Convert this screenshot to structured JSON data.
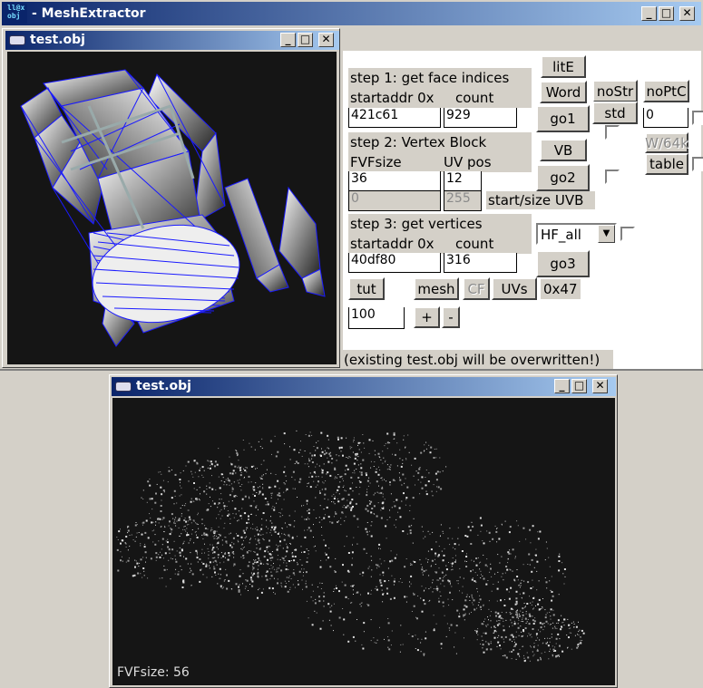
{
  "main_window": {
    "title_icon_line1": "ll@x",
    "title_icon_line2": "obj",
    "title": "- MeshExtractor",
    "minimize": "_",
    "maximize": "□",
    "close": "✕"
  },
  "viewer_top": {
    "title": "test.obj",
    "minimize": "_",
    "maximize": "□",
    "close": "✕"
  },
  "viewer_bottom": {
    "title": "test.obj",
    "minimize": "_",
    "maximize": "□",
    "close": "✕",
    "status": "FVFsize: 56"
  },
  "panel": {
    "step1": {
      "heading": "step 1: get face indices",
      "startaddr_label": "startaddr 0x",
      "count_label": "count",
      "startaddr_value": "421c61",
      "count_value": "929"
    },
    "step2": {
      "heading": "step 2: Vertex Block",
      "fvfsize_label": "FVFsize",
      "uvpos_label": "UV pos",
      "fvfsize_value": "36",
      "uvpos_value": "12",
      "start_value": "0",
      "size_value": "255",
      "startsize_label": "start/size UVB"
    },
    "step3": {
      "heading": "step 3: get vertices",
      "startaddr_label": "startaddr 0x",
      "count_label": "count",
      "startaddr_value": "40df80",
      "count_value": "316"
    },
    "buttons": {
      "lite": "litE",
      "word": "Word",
      "nostr": "noStr",
      "noptc": "noPtC",
      "go1": "go1",
      "std": "std",
      "w64k": "W/64k",
      "vb": "VB",
      "table": "table",
      "go2": "go2",
      "go3": "go3",
      "tut": "tut",
      "mesh": "mesh",
      "cf": "CF",
      "uvs": "UVs",
      "plus": "+",
      "minus": "-"
    },
    "side_field_value": "0",
    "dropdown_value": "HF_all",
    "dropdown_arrow": "▼",
    "hex_label": "0x47",
    "scale_value": "100",
    "warning": "(existing test.obj will be overwritten!)"
  },
  "colors": {
    "titlebar_start": "#0a246a",
    "titlebar_end": "#a6caf0",
    "viewport_bg": "#151515",
    "wire": "#1a1aff"
  }
}
